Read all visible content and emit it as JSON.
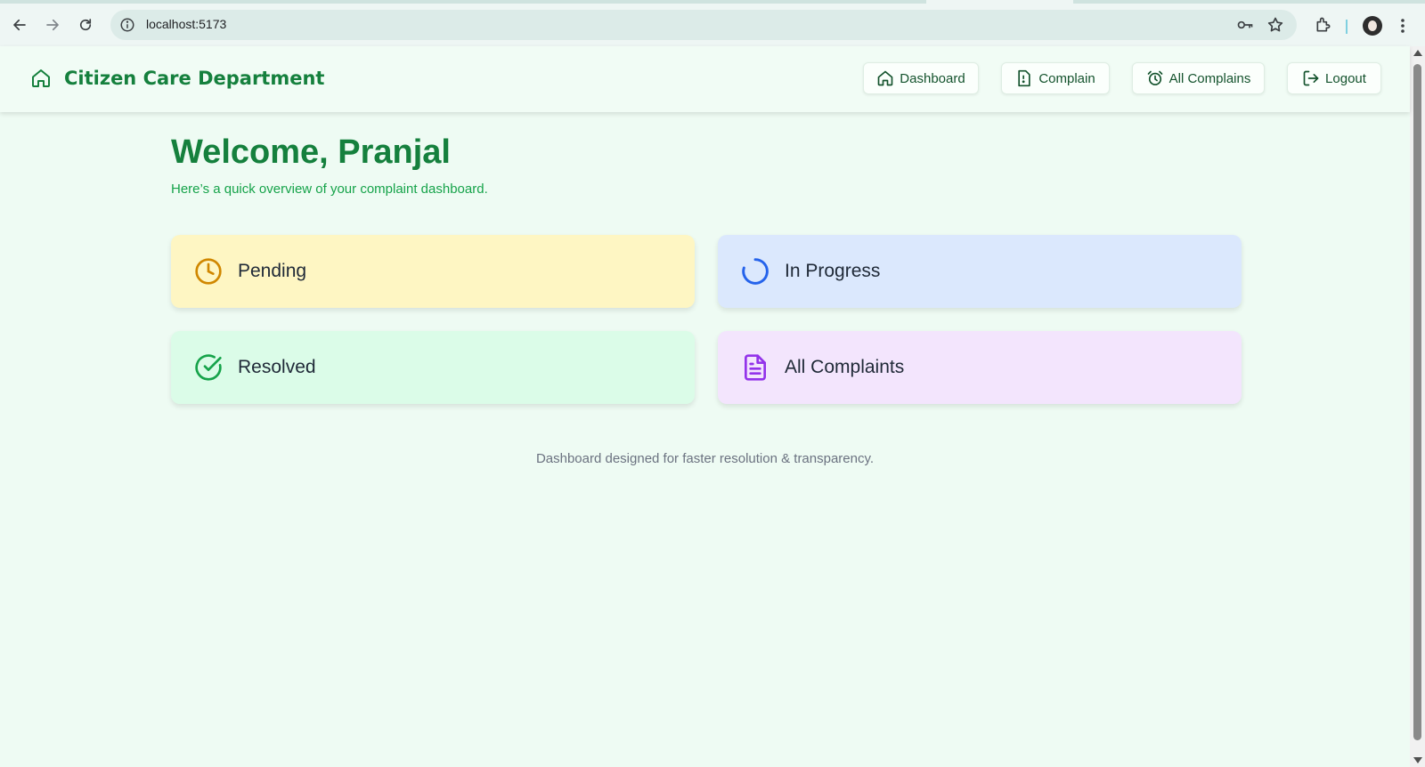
{
  "browser": {
    "url": "localhost:5173",
    "icons": [
      "back-arrow-icon",
      "forward-arrow-icon",
      "reload-icon",
      "site-info-icon",
      "password-key-icon",
      "bookmark-star-icon",
      "extensions-icon",
      "profile-avatar",
      "more-menu-icon"
    ]
  },
  "header": {
    "title": "Citizen Care Department",
    "nav": {
      "dashboard": "Dashboard",
      "complain": "Complain",
      "all_complains": "All Complains",
      "logout": "Logout"
    }
  },
  "main": {
    "welcome": "Welcome, Pranjal",
    "subtitle": "Here’s a quick overview of your complaint dashboard.",
    "cards": {
      "pending": "Pending",
      "in_progress": "In Progress",
      "resolved": "Resolved",
      "all_complaints": "All Complaints"
    },
    "footer": "Dashboard designed for faster resolution & transparency."
  },
  "colors": {
    "brand_green": "#15803d",
    "pending_bg": "#fef6c3",
    "in_progress_bg": "#dbe8fd",
    "resolved_bg": "#dbfce8",
    "all_complaints_bg": "#f3e5fd"
  }
}
